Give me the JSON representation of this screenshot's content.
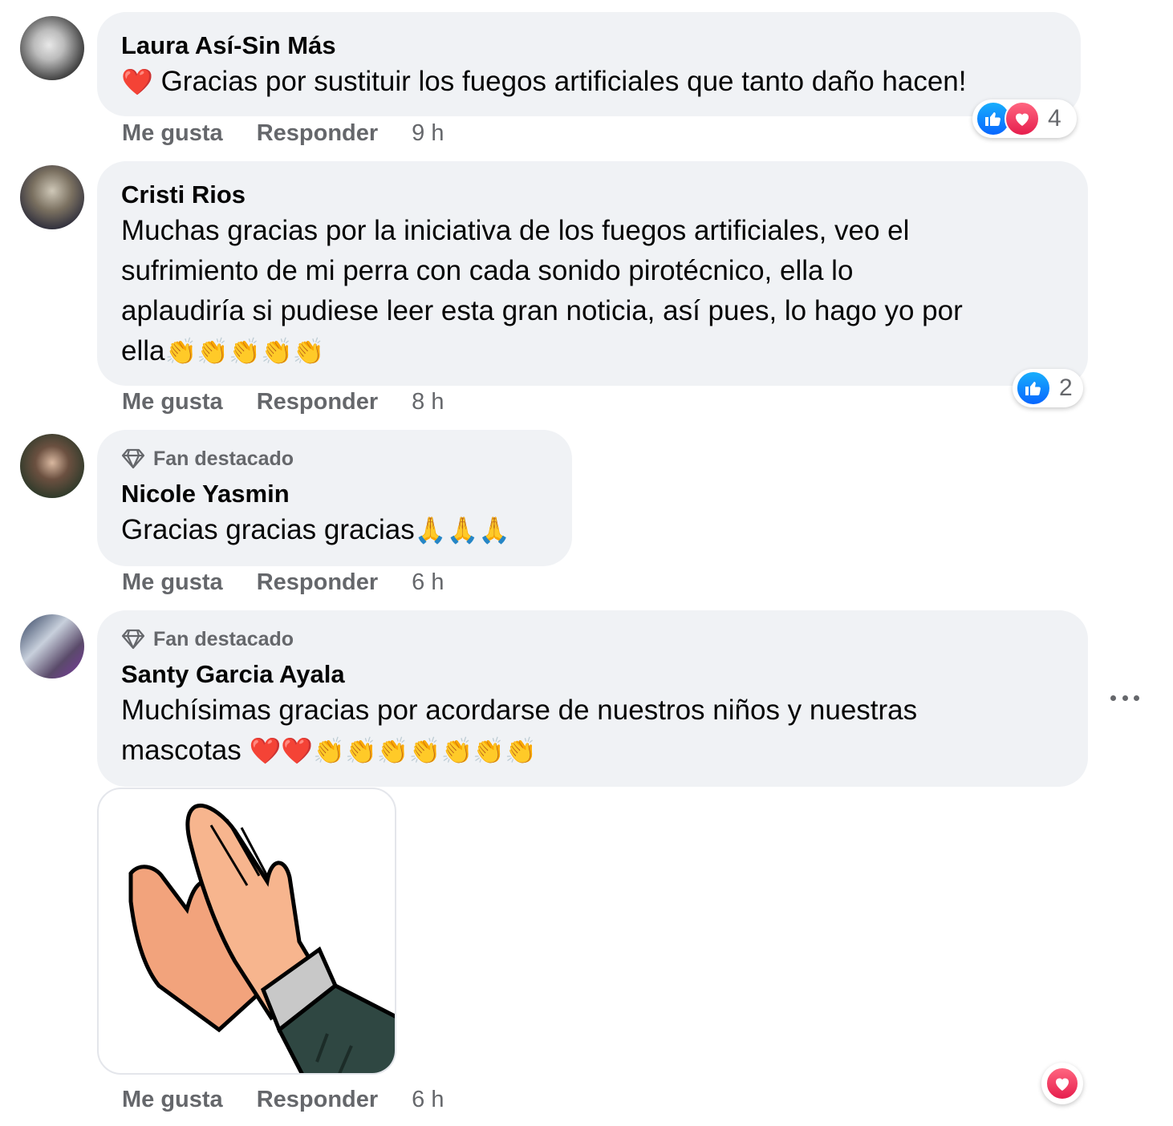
{
  "comments": [
    {
      "author": "Laura Así-Sin Más",
      "prefix_emoji": "❤️",
      "text": "Gracias por sustituir los fuegos artificiales que tanto daño hacen!",
      "like_label": "Me gusta",
      "reply_label": "Responder",
      "time": "9 h",
      "reaction_count": "4"
    },
    {
      "author": "Cristi Rios",
      "lines": [
        "Muchas gracias por la iniciativa de los fuegos artificiales, veo el",
        "sufrimiento de mi perra con cada sonido pirotécnico, ella lo",
        "aplaudiría si pudiese leer esta gran noticia, así pues, lo hago yo por",
        "ella"
      ],
      "trailing_emoji": "👏👏👏👏👏",
      "like_label": "Me gusta",
      "reply_label": "Responder",
      "time": "8 h",
      "reaction_count": "2"
    },
    {
      "badge": "Fan destacado",
      "author": "Nicole Yasmin",
      "text": "Gracias gracias gracias",
      "trailing_emoji": "🙏🙏🙏",
      "like_label": "Me gusta",
      "reply_label": "Responder",
      "time": "6 h"
    },
    {
      "badge": "Fan destacado",
      "author": "Santy Garcia Ayala",
      "lines": [
        "Muchísimas gracias por acordarse de nuestros niños y nuestras",
        "mascotas "
      ],
      "trailing_emoji": "❤️❤️👏👏👏👏👏👏👏",
      "like_label": "Me gusta",
      "reply_label": "Responder",
      "time": "6 h"
    }
  ],
  "colors": {
    "bubble": "#f0f2f5",
    "secondary_text": "#65676b",
    "like_blue": "#0866ff",
    "love_red": "#e61e4d"
  },
  "icons": [
    "like-icon",
    "love-icon",
    "diamond-badge-icon",
    "more-options-icon",
    "clapping-hands-sticker"
  ]
}
